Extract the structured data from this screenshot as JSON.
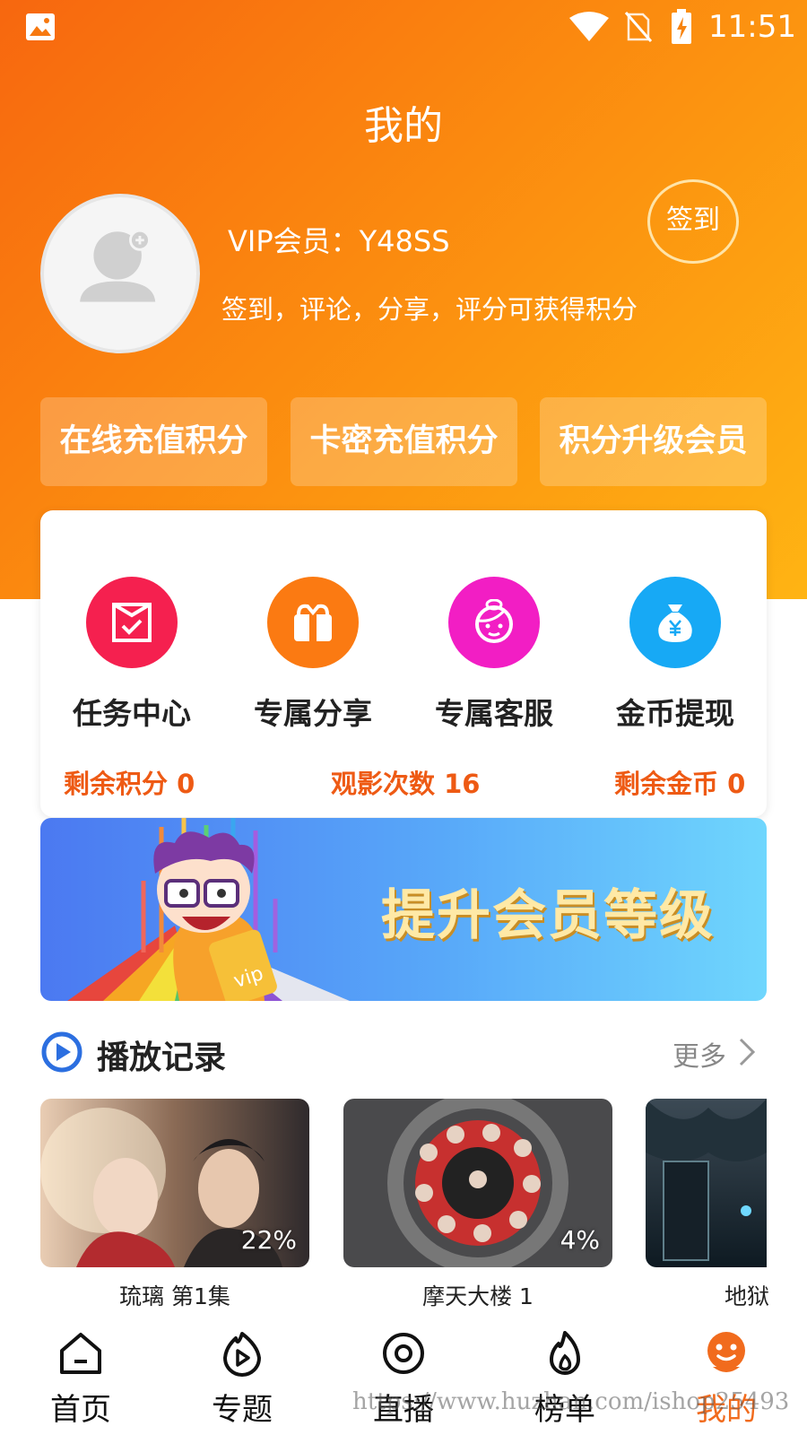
{
  "status_bar": {
    "time": "11:51"
  },
  "page": {
    "title": "我的"
  },
  "profile": {
    "vip_line": "VIP会员：Y48SS",
    "hint": "签到，评论，分享，评分可获得积分",
    "signin_label": "签到"
  },
  "quick_actions": [
    {
      "label": "在线充值积分"
    },
    {
      "label": "卡密充值积分"
    },
    {
      "label": "积分升级会员"
    }
  ],
  "features": [
    {
      "label": "任务中心",
      "icon": "task-icon",
      "color": "#f5204f"
    },
    {
      "label": "专属分享",
      "icon": "gift-icon",
      "color": "#fb7a12"
    },
    {
      "label": "专属客服",
      "icon": "service-icon",
      "color": "#f21ec4"
    },
    {
      "label": "金币提现",
      "icon": "money-bag-icon",
      "color": "#17a9f5"
    }
  ],
  "stats": [
    {
      "text": "剩余积分 0"
    },
    {
      "text": "观影次数 16"
    },
    {
      "text": "剩余金币 0"
    }
  ],
  "banner": {
    "text": "提升会员等级",
    "badge": "vip"
  },
  "history": {
    "title": "播放记录",
    "more": "更多",
    "items": [
      {
        "title": "琉璃 第1集",
        "progress": "22%"
      },
      {
        "title": "摩天大楼 1",
        "progress": "4%"
      },
      {
        "title": "地狱"
      }
    ]
  },
  "tabs": [
    {
      "label": "首页",
      "icon": "home-icon"
    },
    {
      "label": "专题",
      "icon": "topic-icon"
    },
    {
      "label": "直播",
      "icon": "live-icon"
    },
    {
      "label": "榜单",
      "icon": "flame-icon"
    },
    {
      "label": "我的",
      "icon": "profile-icon",
      "active": true
    }
  ],
  "watermark": "https://www.huzhan.com/ishop25493",
  "colors": {
    "accent": "#f16b1d",
    "gradient_start": "#f7670f",
    "gradient_end": "#ffb413"
  }
}
